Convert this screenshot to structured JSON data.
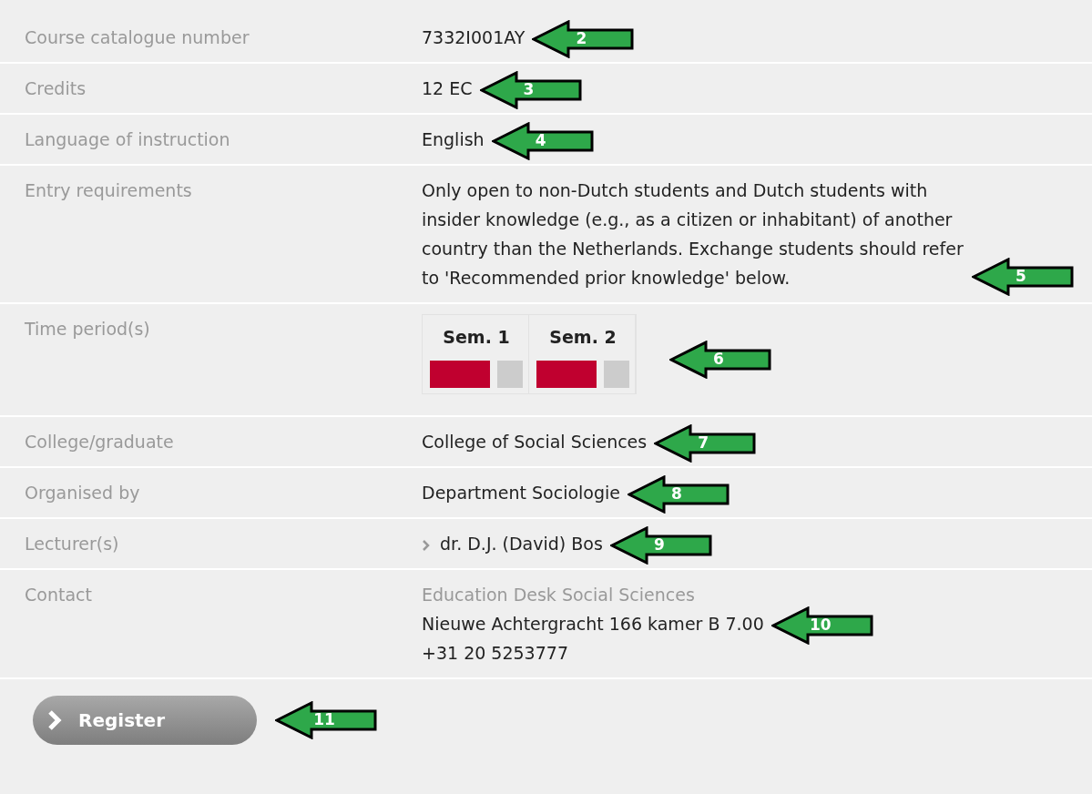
{
  "rows": [
    {
      "label": "Course catalogue number",
      "kind": "text",
      "value": "7332I001AY",
      "callout": "2"
    },
    {
      "label": "Credits",
      "kind": "text",
      "value": "12 EC",
      "callout": "3"
    },
    {
      "label": "Language of instruction",
      "kind": "text",
      "value": "English",
      "callout": "4"
    },
    {
      "label": "Entry requirements",
      "kind": "paragraph",
      "value": "Only open to non-Dutch students and Dutch students with insider knowledge (e.g., as a citizen or inhabitant) of another country than the Netherlands. Exchange students should refer to 'Recommended prior knowledge' below.",
      "callout": "5"
    },
    {
      "label": "Time period(s)",
      "kind": "periods",
      "periods": [
        {
          "label": "Sem. 1",
          "blocks": [
            {
              "active": true
            },
            {
              "active": false
            }
          ]
        },
        {
          "label": "Sem. 2",
          "blocks": [
            {
              "active": true
            },
            {
              "active": false
            }
          ]
        }
      ],
      "callout": "6"
    },
    {
      "label": "College/graduate",
      "kind": "text",
      "value": "College of Social Sciences",
      "callout": "7"
    },
    {
      "label": "Organised by",
      "kind": "text",
      "value": "Department Sociologie",
      "callout": "8"
    },
    {
      "label": "Lecturer(s)",
      "kind": "link",
      "value": "dr. D.J. (David) Bos",
      "callout": "9"
    },
    {
      "label": "Contact",
      "kind": "contact",
      "heading": "Education Desk Social Sciences",
      "lines": [
        "Nieuwe Achtergracht 166 kamer B 7.00",
        "+31 20 5253777"
      ],
      "callout": "10"
    }
  ],
  "register_button": {
    "label": "Register",
    "callout": "11"
  }
}
